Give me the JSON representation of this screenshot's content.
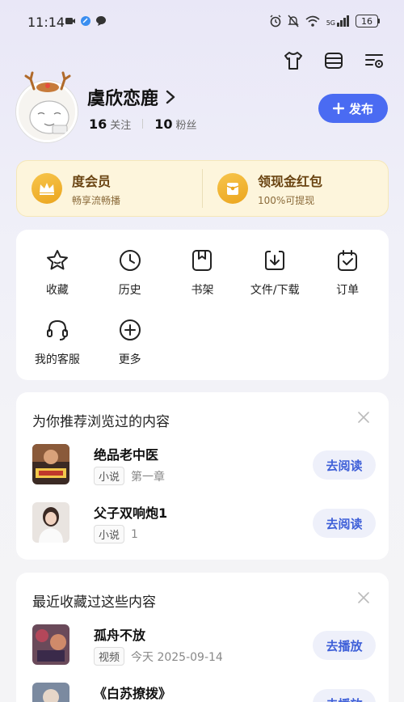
{
  "status": {
    "time": "11:14",
    "network": "5G",
    "battery": "16"
  },
  "header_actions": [
    {
      "icon": "tshirt-icon"
    },
    {
      "icon": "menu-icon"
    },
    {
      "icon": "settings-list-icon"
    }
  ],
  "profile": {
    "username": "虞欣恋鹿",
    "following_count": "16",
    "following_label": "关注",
    "followers_count": "10",
    "followers_label": "粉丝",
    "publish_label": "发布"
  },
  "vip": {
    "member_title": "度会员",
    "member_sub": "畅享流畅播",
    "redpacket_title": "领现金红包",
    "redpacket_sub": "100%可提现"
  },
  "grid": [
    {
      "icon": "star-icon",
      "label": "收藏"
    },
    {
      "icon": "clock-icon",
      "label": "历史"
    },
    {
      "icon": "bookmark-icon",
      "label": "书架"
    },
    {
      "icon": "download-icon",
      "label": "文件/下载"
    },
    {
      "icon": "calendar-check-icon",
      "label": "订单"
    },
    {
      "icon": "headset-icon",
      "label": "我的客服"
    },
    {
      "icon": "plus-circle-icon",
      "label": "更多"
    }
  ],
  "recommend": {
    "title": "为你推荐浏览过的内容",
    "items": [
      {
        "name": "绝品老中医",
        "tag": "小说",
        "meta": "第一章",
        "action": "去阅读"
      },
      {
        "name": "父子双响炮1",
        "tag": "小说",
        "meta": "1",
        "action": "去阅读"
      }
    ]
  },
  "favorites": {
    "title": "最近收藏过这些内容",
    "items": [
      {
        "name": "孤舟不放",
        "tag": "视频",
        "meta": "今天  2025-09-14",
        "action": "去播放"
      },
      {
        "name": "《白苏撩拨》",
        "tag": "",
        "meta": "",
        "action": "去播放"
      }
    ]
  },
  "colors": {
    "accent": "#4a6bf2",
    "vip_bg": "#fdf5dc",
    "gold": "#eba51e"
  }
}
